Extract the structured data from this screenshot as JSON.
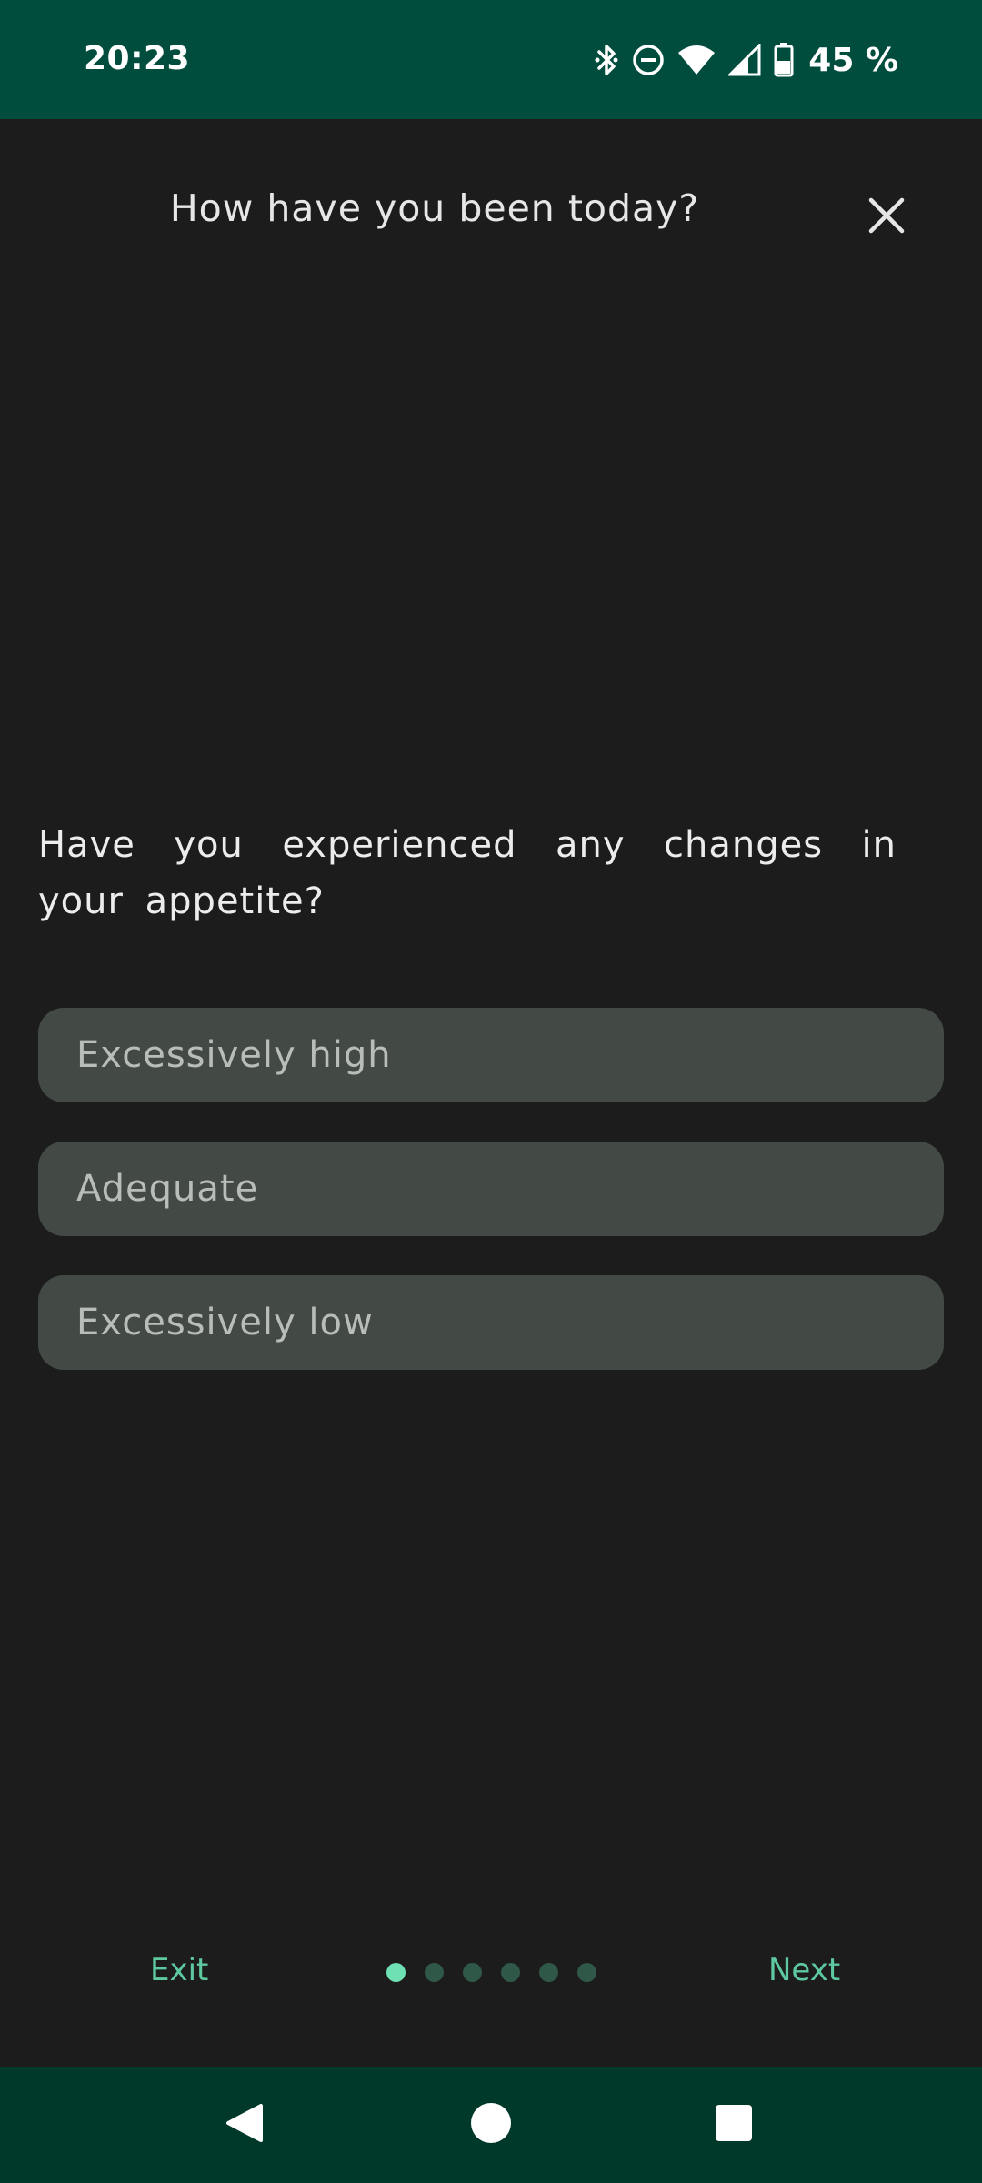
{
  "status_bar": {
    "time": "20:23",
    "battery": "45 %",
    "icons": [
      "bluetooth-icon",
      "do-not-disturb-icon",
      "wifi-icon",
      "cellular-signal-icon",
      "battery-icon"
    ]
  },
  "header": {
    "title": "How have you been today?",
    "close_icon": "close-icon"
  },
  "question": {
    "text": "Have you experienced any changes in your appetite?"
  },
  "options": [
    {
      "label": "Excessively high"
    },
    {
      "label": "Adequate"
    },
    {
      "label": "Excessively low"
    }
  ],
  "footer": {
    "exit_label": "Exit",
    "next_label": "Next",
    "pagination": {
      "current": 1,
      "total": 6
    }
  },
  "nav_bar": {
    "buttons": [
      "back-icon",
      "home-icon",
      "recents-icon"
    ]
  },
  "colors": {
    "status_bar_bg": "#004d3d",
    "background": "#1b1c1b",
    "option_bg": "#434a46",
    "accent": "#5ec9a0",
    "dot_active": "#6fe0b4",
    "dot_inactive": "#305848",
    "nav_bar_bg": "#00382a"
  }
}
